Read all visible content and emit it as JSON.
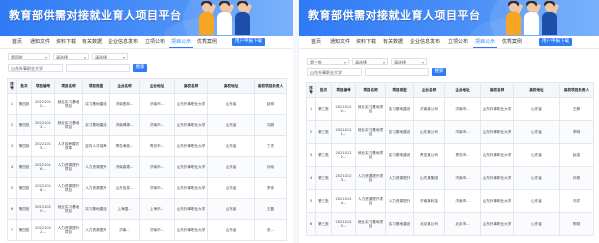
{
  "left": {
    "banner_title": "教育部供需对接就业育人项目平台",
    "nav": {
      "items": [
        "首页",
        "通知文件",
        "资料下载",
        "有关数据",
        "企业信息发布",
        "立项公布",
        "项目公示",
        "优秀案例"
      ],
      "active_index": 6,
      "button": "用户申报下载"
    },
    "filters": {
      "batch": "第四批",
      "type": "请选择",
      "project_type": "请选择",
      "school": "山东外事职业大学",
      "search": "搜索"
    },
    "table": {
      "headers": [
        "序号",
        "批次",
        "项目编号",
        "项目名称",
        "项目类型",
        "企业名称",
        "企业地址",
        "高校名称",
        "高校地址",
        "高校项目负责人"
      ],
      "rows": [
        [
          "1",
          "第四批",
          "20221010...",
          "就业实习基地项目",
          "实习基地建设",
          "济南鲁邦...",
          "济南市...",
          "山东外事职业大学",
          "山东省",
          "赵明"
        ],
        [
          "2",
          "第四批",
          "20221012...",
          "就业实习基地项目",
          "实习基地建设",
          "济南博源...",
          "济南市...",
          "山东外事职业大学",
          "山东省",
          "刘超"
        ],
        [
          "3",
          "第四批",
          "20221015...",
          "人才培养模式改革",
          "定向人才培养",
          "青岛海信...",
          "青岛市...",
          "山东外事职业大学",
          "山东省",
          "丁杰"
        ],
        [
          "4",
          "第四批",
          "20221016...",
          "人力资源提升项目",
          "人力资源提升",
          "济南高德...",
          "济南市...",
          "山东外事职业大学",
          "山东省",
          "孙晓"
        ],
        [
          "5",
          "第四批",
          "20221018...",
          "人力资源提升项目",
          "人力资源提升",
          "山东信息...",
          "济南市...",
          "山东外事职业大学",
          "山东省",
          "李伟"
        ],
        [
          "6",
          "第四批",
          "20221020...",
          "就业实习基地项目",
          "实习基地建设",
          "上海国...",
          "上海市...",
          "山东外事职业大学",
          "山东省",
          "王磊"
        ],
        [
          "7",
          "第四批",
          "20221022...",
          "人力资源提升项目",
          "人力资源提升",
          "济南...",
          "济南市...",
          "山东外事职业大学",
          "山东省",
          "张..."
        ]
      ]
    }
  },
  "right": {
    "banner_title": "教育部供需对接就业育人项目平台",
    "nav": {
      "items": [
        "首页",
        "通知文件",
        "资料下载",
        "有关数据",
        "企业信息发布",
        "立项公布",
        "项目公示",
        "优秀案例"
      ],
      "active_index": 6,
      "button": "用户申报下载"
    },
    "filters": {
      "batch": "第三批",
      "type": "请选择",
      "project_type": "请选择",
      "school": "山东外事职业大学",
      "search": "搜索"
    },
    "table": {
      "headers": [
        "序号",
        "批次",
        "项目编号",
        "项目名称",
        "项目类型",
        "企业名称",
        "企业地址",
        "高校名称",
        "高校地址",
        "高校项目负责人"
      ],
      "rows": [
        [
          "1",
          "第三批",
          "20210120...",
          "就业实习基地项目",
          "实习基地建设",
          "济南某公司",
          "济南市...",
          "山东外事职业大学",
          "山东省",
          "王静"
        ],
        [
          "2",
          "第三批",
          "20210121...",
          "就业实习基地项目",
          "实习基地建设",
          "山东某公司",
          "济南市...",
          "山东外事职业大学",
          "山东省",
          "李明"
        ],
        [
          "3",
          "第三批",
          "20210122...",
          "就业实习基地项目",
          "实习基地建设",
          "青岛某公司",
          "青岛市...",
          "山东外事职业大学",
          "山东省",
          "赵强"
        ],
        [
          "4",
          "第三批",
          "20210123...",
          "人力资源提升项目",
          "人力资源提升",
          "山东某集团",
          "济南市...",
          "山东外事职业大学",
          "山东省",
          "孙丽"
        ],
        [
          "5",
          "第三批",
          "20210124...",
          "人力资源提升项目",
          "人力资源提升",
          "济南某科技",
          "济南市...",
          "山东外事职业大学",
          "山东省",
          "刘洋"
        ],
        [
          "6",
          "第三批",
          "20210125...",
          "就业实习基地项目",
          "实习基地建设",
          "北京某公司",
          "北京市...",
          "山东外事职业大学",
          "山东省",
          "陈刚"
        ]
      ]
    }
  }
}
